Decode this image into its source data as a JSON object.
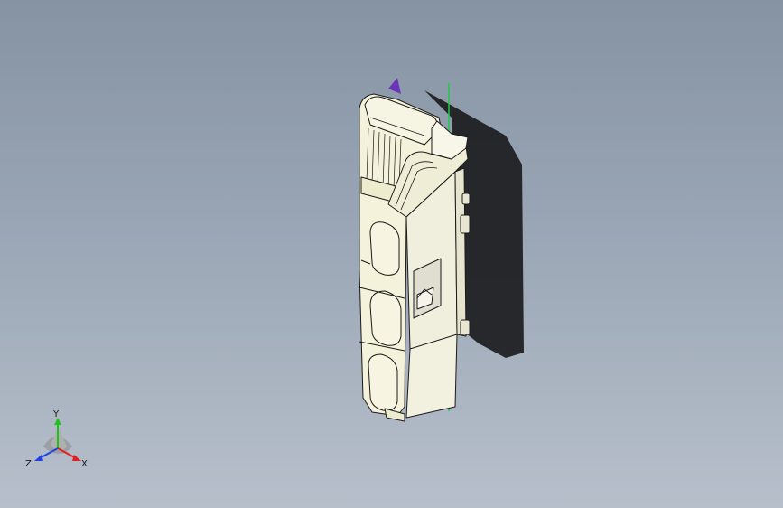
{
  "viewport": {
    "background_top": "#8593a3",
    "background_bottom": "#b7bfcb",
    "model_body_color": "#f4f2da",
    "model_outline_color": "#1a1a1a",
    "shadow_color": "#1c1c1e",
    "axis_line_color": "#22c84a",
    "sketch_marker_color": "#6a35b8"
  },
  "triad": {
    "x_label": "X",
    "y_label": "Y",
    "z_label": "Z",
    "x_color": "#e02020",
    "y_color": "#20c020",
    "z_color": "#2040e0"
  }
}
